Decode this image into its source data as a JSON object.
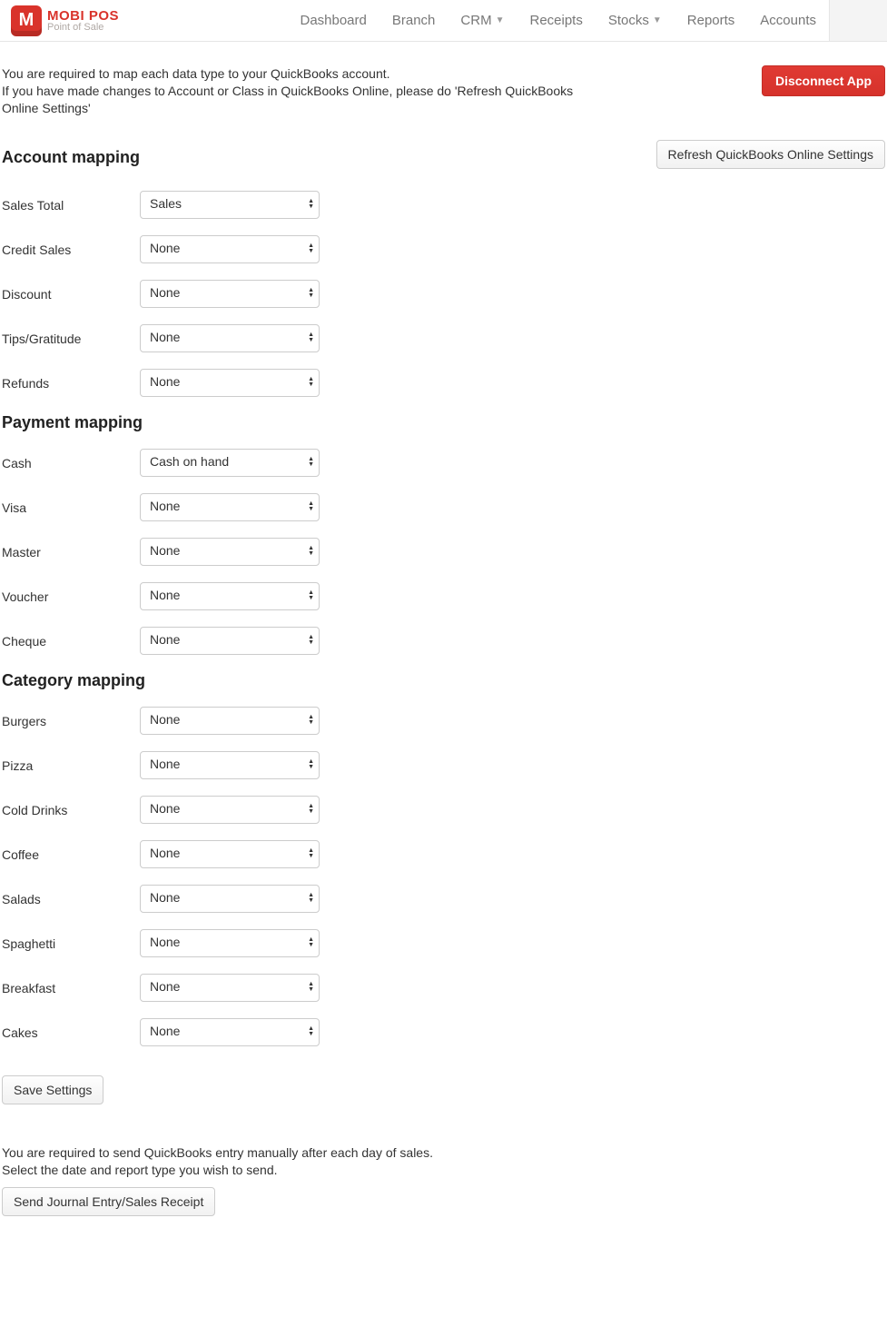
{
  "logo": {
    "icon_letter": "M",
    "title": "MOBI POS",
    "subtitle": "Point of Sale"
  },
  "nav": {
    "dashboard": "Dashboard",
    "branch": "Branch",
    "crm": "CRM",
    "receipts": "Receipts",
    "stocks": "Stocks",
    "reports": "Reports",
    "accounts": "Accounts"
  },
  "intro": {
    "line1": "You are required to map each data type to your QuickBooks account.",
    "line2": "If you have made changes to Account or Class in QuickBooks Online, please do 'Refresh QuickBooks Online Settings'"
  },
  "buttons": {
    "disconnect": "Disconnect App",
    "refresh": "Refresh QuickBooks Online Settings",
    "save": "Save Settings",
    "send": "Send Journal Entry/Sales Receipt"
  },
  "sections": {
    "account": "Account mapping",
    "payment": "Payment mapping",
    "category": "Category mapping"
  },
  "account_mapping": {
    "sales_total": {
      "label": "Sales Total",
      "value": "Sales"
    },
    "credit_sales": {
      "label": "Credit Sales",
      "value": "None"
    },
    "discount": {
      "label": "Discount",
      "value": "None"
    },
    "tips": {
      "label": "Tips/Gratitude",
      "value": "None"
    },
    "refunds": {
      "label": "Refunds",
      "value": "None"
    }
  },
  "payment_mapping": {
    "cash": {
      "label": "Cash",
      "value": "Cash on hand"
    },
    "visa": {
      "label": "Visa",
      "value": "None"
    },
    "master": {
      "label": "Master",
      "value": "None"
    },
    "voucher": {
      "label": "Voucher",
      "value": "None"
    },
    "cheque": {
      "label": "Cheque",
      "value": "None"
    }
  },
  "category_mapping": {
    "burgers": {
      "label": "Burgers",
      "value": "None"
    },
    "pizza": {
      "label": "Pizza",
      "value": "None"
    },
    "cold_drinks": {
      "label": "Cold Drinks",
      "value": "None"
    },
    "coffee": {
      "label": "Coffee",
      "value": "None"
    },
    "salads": {
      "label": "Salads",
      "value": "None"
    },
    "spaghetti": {
      "label": "Spaghetti",
      "value": "None"
    },
    "breakfast": {
      "label": "Breakfast",
      "value": "None"
    },
    "cakes": {
      "label": "Cakes",
      "value": "None"
    }
  },
  "footer": {
    "line1": "You are required to send QuickBooks entry manually after each day of sales.",
    "line2": "Select the date and report type you wish to send."
  }
}
